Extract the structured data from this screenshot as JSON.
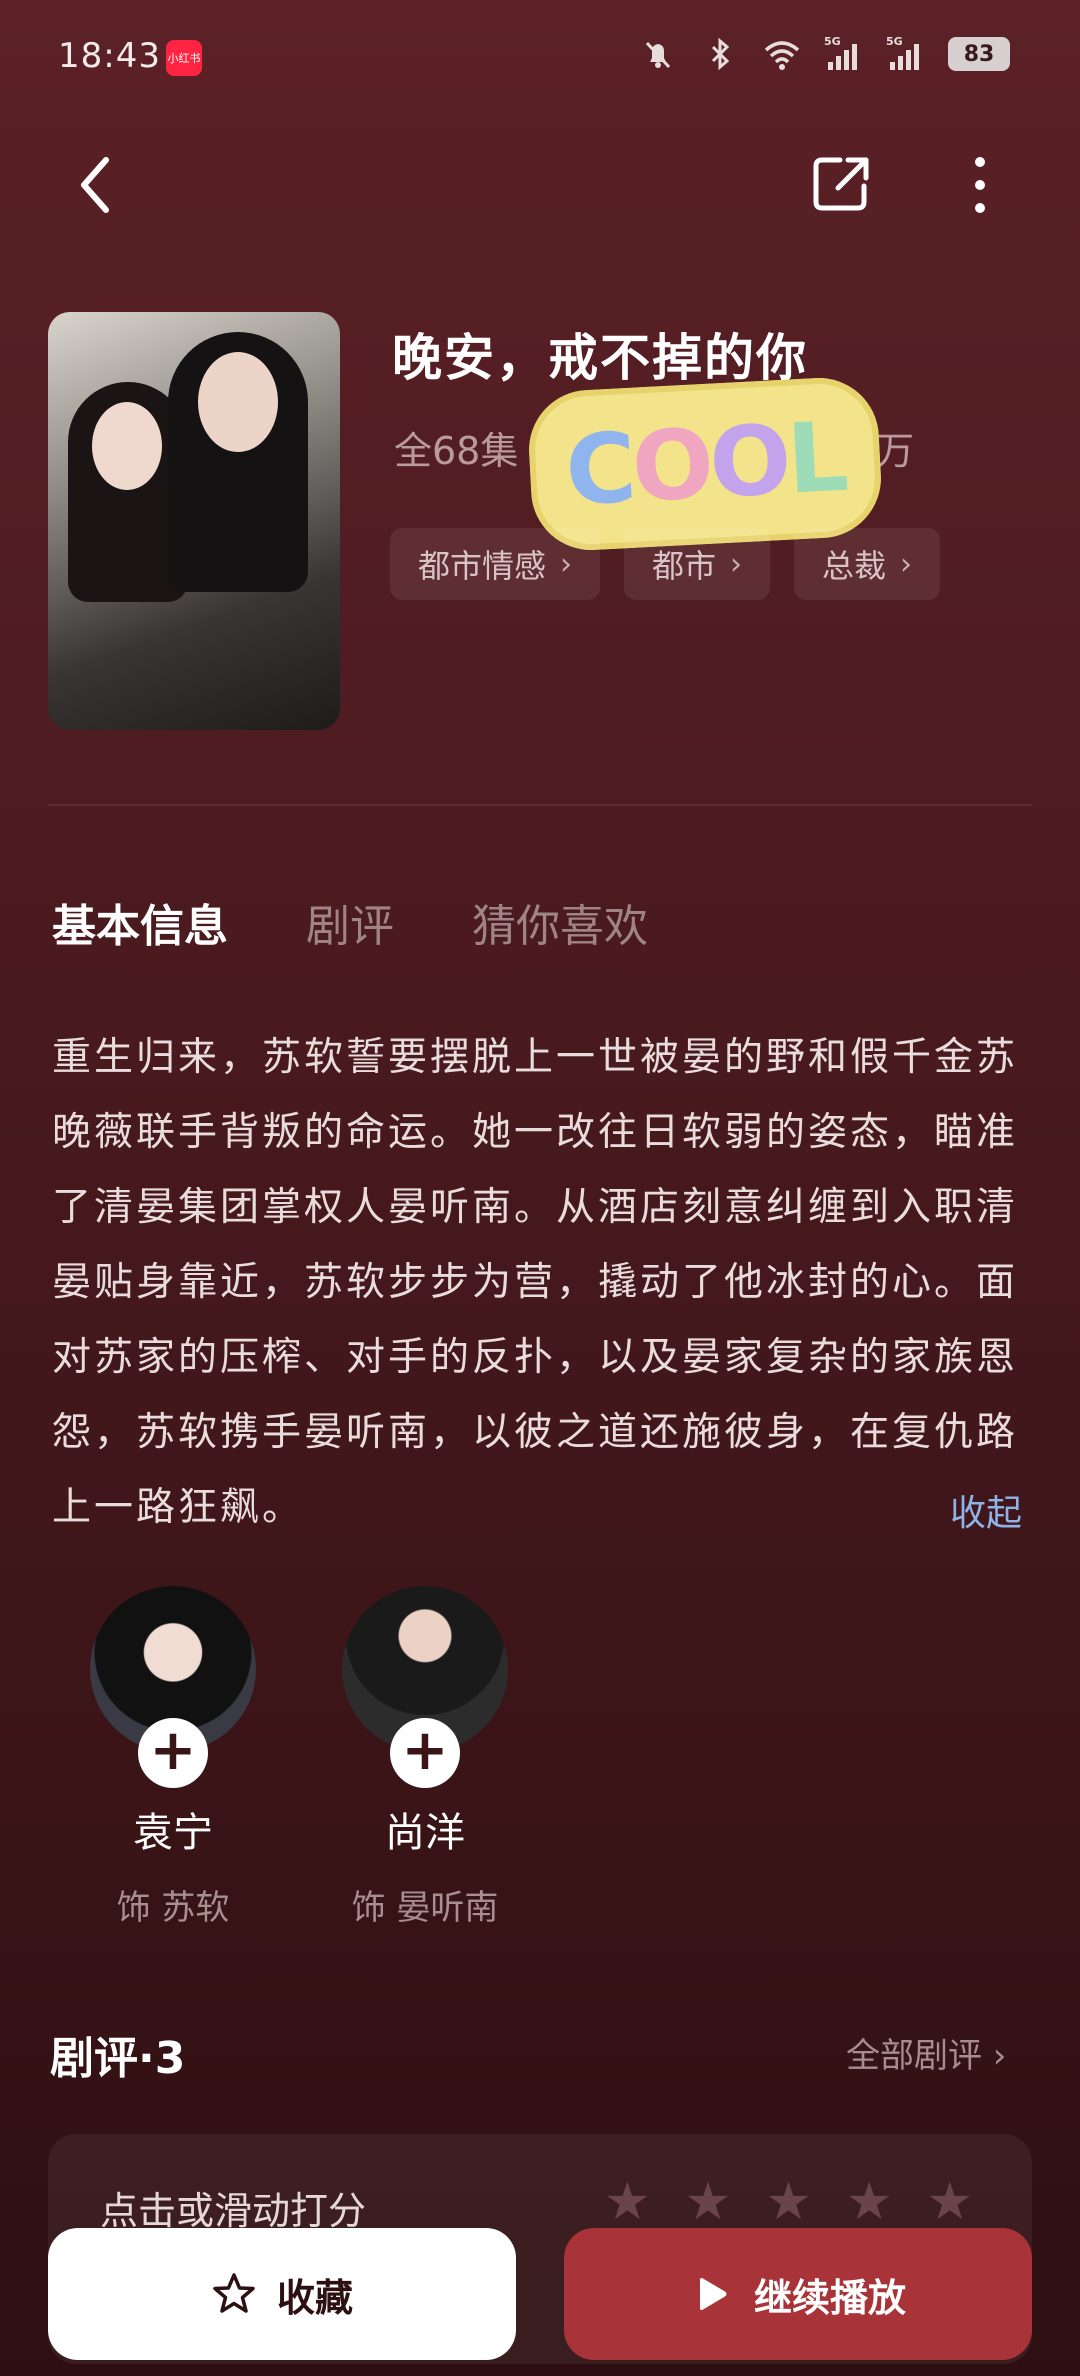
{
  "status_bar": {
    "time": "18:43",
    "app_badge": "小红书",
    "battery": "83",
    "network1": "5G",
    "network2": "5G"
  },
  "drama": {
    "title": "晚安，戒不掉的你",
    "episodes": "全68集",
    "views": "3万",
    "sticker_text": "COOL",
    "poster_title": "晚安，戒不掉的你",
    "tags": [
      {
        "label": "都市情感"
      },
      {
        "label": "都市"
      },
      {
        "label": "总裁"
      }
    ]
  },
  "tabs": [
    {
      "label": "基本信息"
    },
    {
      "label": "剧评"
    },
    {
      "label": "猜你喜欢"
    }
  ],
  "synopsis": {
    "text": "重生归来，苏软誓要摆脱上一世被晏的野和假千金苏晚薇联手背叛的命运。她一改往日软弱的姿态，瞄准了清晏集团掌权人晏听南。从酒店刻意纠缠到入职清晏贴身靠近，苏软步步为营，撬动了他冰封的心。面对苏家的压榨、对手的反扑，以及晏家复杂的家族恩怨，苏软携手晏听南，以彼之道还施彼身，在复仇路上一路狂飙。",
    "collapse_label": "收起"
  },
  "cast": [
    {
      "name": "袁宁",
      "role": "饰 苏软"
    },
    {
      "name": "尚洋",
      "role": "饰 晏听南"
    }
  ],
  "reviews": {
    "title": "剧评·3",
    "all_label": "全部剧评",
    "rating_prompt": "点击或滑动打分",
    "max_stars": 5
  },
  "actions": {
    "favorite_label": "收藏",
    "play_label": "继续播放"
  },
  "colors": {
    "background": "#4e1c21",
    "play_button": "#a83338",
    "link": "#8db3e8",
    "sticker": "#f3e38a"
  }
}
